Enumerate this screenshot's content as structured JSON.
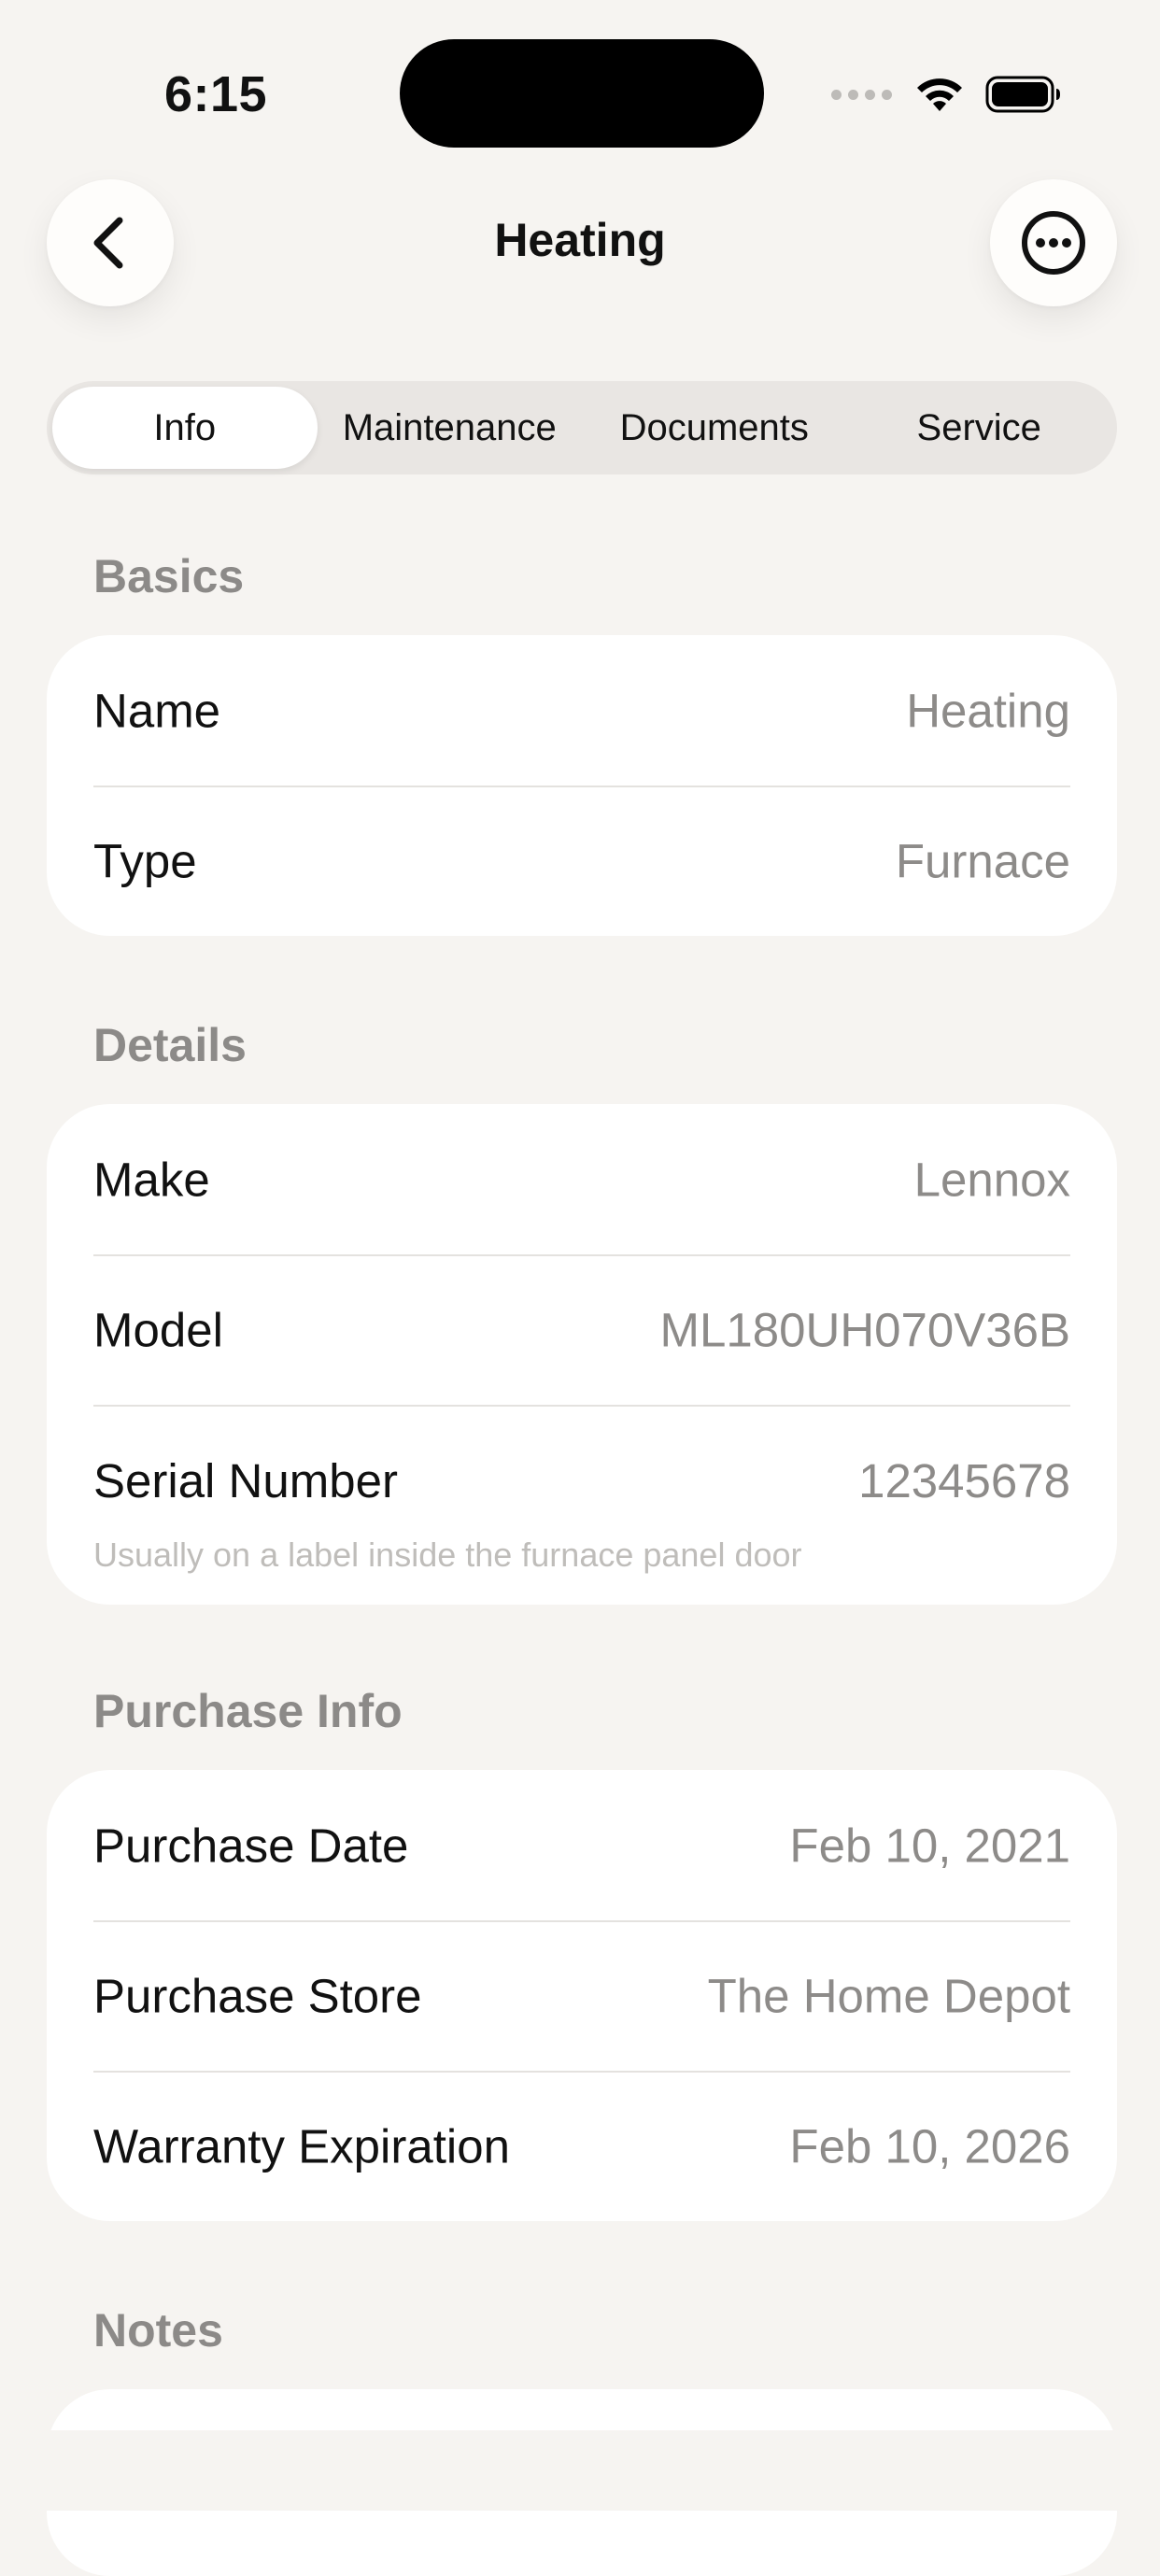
{
  "status_bar": {
    "time": "6:15"
  },
  "nav": {
    "title": "Heating",
    "back_icon": "chevron-left-icon",
    "more_icon": "ellipsis-circle-icon"
  },
  "tabs": [
    {
      "label": "Info",
      "selected": true
    },
    {
      "label": "Maintenance",
      "selected": false
    },
    {
      "label": "Documents",
      "selected": false
    },
    {
      "label": "Service",
      "selected": false
    }
  ],
  "sections": {
    "basics": {
      "title": "Basics",
      "rows": [
        {
          "label": "Name",
          "value": "Heating"
        },
        {
          "label": "Type",
          "value": "Furnace"
        }
      ]
    },
    "details": {
      "title": "Details",
      "rows": [
        {
          "label": "Make",
          "value": "Lennox"
        },
        {
          "label": "Model",
          "value": "ML180UH070V36B"
        },
        {
          "label": "Serial Number",
          "value": "12345678",
          "hint": "Usually on a label inside the furnace panel door"
        }
      ]
    },
    "purchase": {
      "title": "Purchase Info",
      "rows": [
        {
          "label": "Purchase Date",
          "value": "Feb 10, 2021"
        },
        {
          "label": "Purchase Store",
          "value": "The Home Depot"
        },
        {
          "label": "Warranty Expiration",
          "value": "Feb 10, 2026"
        }
      ]
    },
    "notes": {
      "title": "Notes"
    }
  },
  "colors": {
    "background": "#F6F4F1",
    "card": "#FFFFFF",
    "section_label": "#8C8A88",
    "value_text": "#8D8B89",
    "segment_track": "#E9E6E3"
  }
}
